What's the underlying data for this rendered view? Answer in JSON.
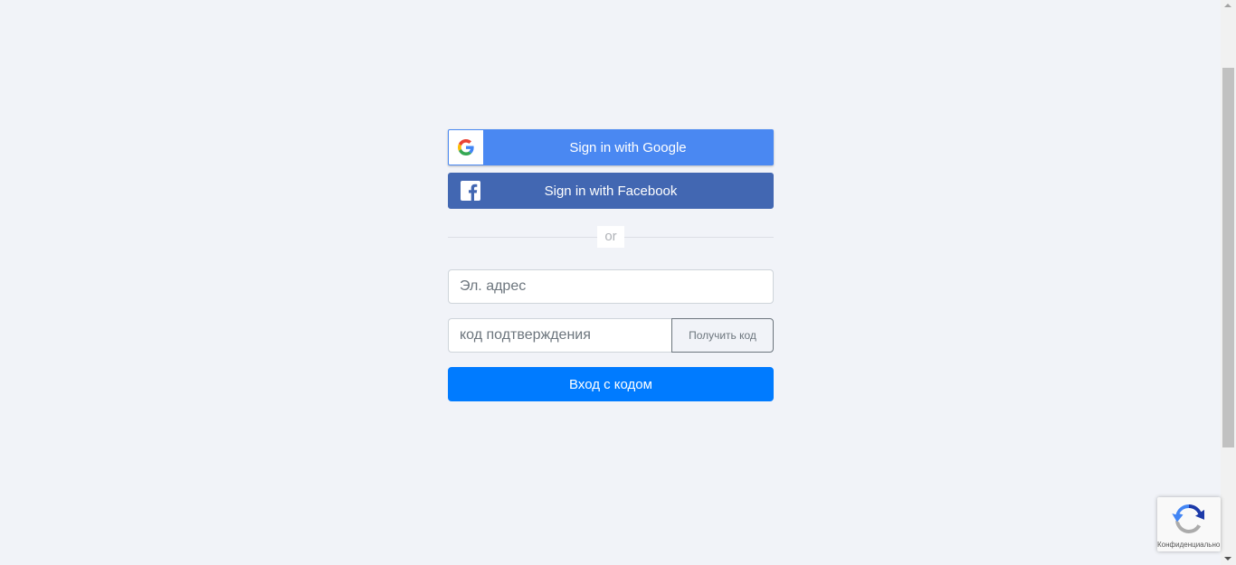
{
  "login": {
    "google_label": "Sign in with Google",
    "facebook_label": "Sign in with Facebook",
    "divider_text": "or",
    "email_placeholder": "Эл. адрес",
    "code_placeholder": "код подтверждения",
    "get_code_label": "Получить код",
    "submit_label": "Вход с кодом"
  },
  "recaptcha": {
    "text": "Конфиденциально"
  },
  "icons": {
    "google": "google-g-icon",
    "facebook": "facebook-f-icon",
    "recaptcha": "recaptcha-logo-icon"
  },
  "colors": {
    "background": "#f1f3f8",
    "google": "#4a88f2",
    "facebook": "#4267b2",
    "primary": "#007bff"
  }
}
